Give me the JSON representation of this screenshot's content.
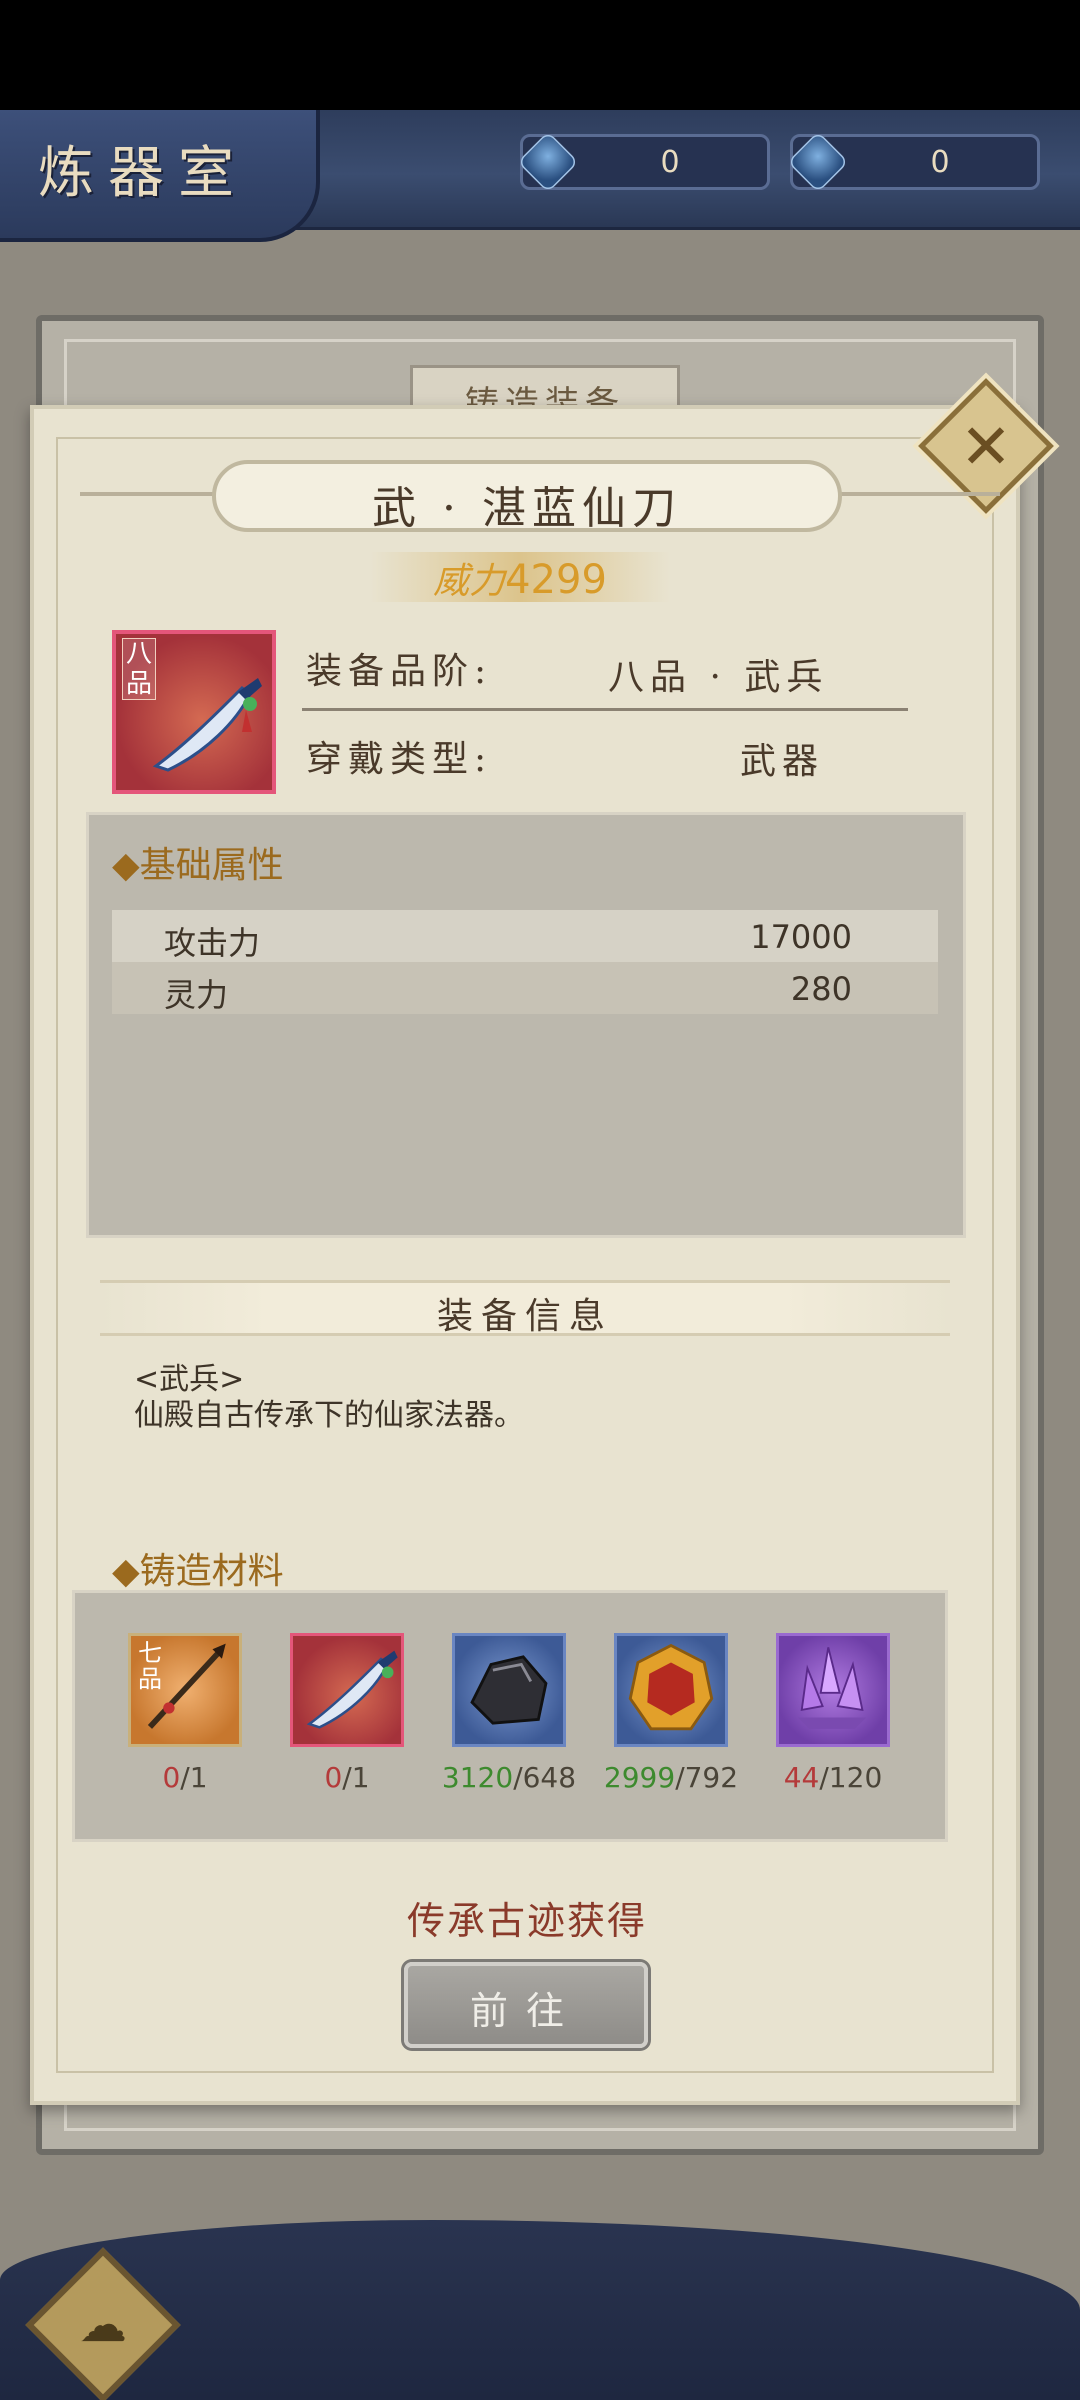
{
  "header": {
    "title": "炼器室",
    "currencies": [
      {
        "icon": "blue-feather-crystal-icon",
        "value": "0"
      },
      {
        "icon": "blue-crystal-shard-icon",
        "value": "0"
      }
    ]
  },
  "background_tab": "铸造装备",
  "item": {
    "name": "武 · 湛蓝仙刀",
    "power_label": "威力",
    "power_value": "4299",
    "grade_badge": "八品",
    "icon": "blue-saber-icon",
    "quality_label": "装备品阶:",
    "quality_value": "八品 · 武兵",
    "wear_label": "穿戴类型:",
    "wear_value": "武器"
  },
  "base_attributes": {
    "heading": "◆基础属性",
    "rows": [
      {
        "name": "攻击力",
        "value": "17000"
      },
      {
        "name": "灵力",
        "value": "280"
      }
    ]
  },
  "equip_info": {
    "heading": "装备信息",
    "line1": "<武兵>",
    "line2": "仙殿自古传承下的仙家法器。"
  },
  "materials": {
    "heading": "◆铸造材料",
    "items": [
      {
        "icon": "seventh-grade-spear-icon",
        "badge": "七品",
        "have": "0",
        "need": "/1",
        "status": "red"
      },
      {
        "icon": "blue-saber-icon",
        "badge": "",
        "have": "0",
        "need": "/1",
        "status": "red"
      },
      {
        "icon": "dark-ore-icon",
        "badge": "",
        "have": "3120",
        "need": "/648",
        "status": "green"
      },
      {
        "icon": "amber-gem-icon",
        "badge": "",
        "have": "2999",
        "need": "/792",
        "status": "green"
      },
      {
        "icon": "purple-crystal-icon",
        "badge": "",
        "have": "44",
        "need": "/120",
        "status": "red"
      }
    ]
  },
  "source_text": "传承古迹获得",
  "go_button": "前往",
  "colors": {
    "accent_gold": "#d89b2a",
    "insufficient": "#b43a3a",
    "sufficient": "#3d8a2e"
  }
}
